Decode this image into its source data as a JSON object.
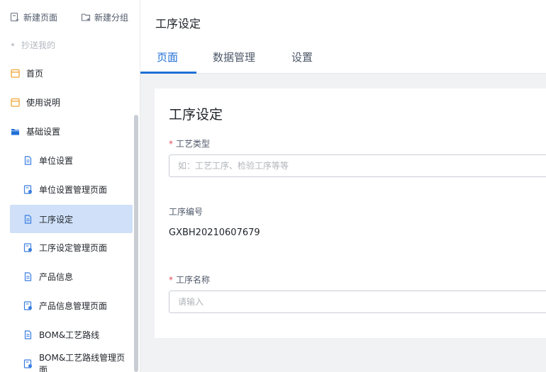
{
  "sidebar": {
    "actions": {
      "new_page": "新建页面",
      "new_group": "新建分组"
    },
    "sub_item": "抄送我的",
    "items": [
      {
        "label": "首页",
        "icon": "calendar-icon"
      },
      {
        "label": "使用说明",
        "icon": "calendar-icon"
      },
      {
        "label": "基础设置",
        "icon": "folder-icon"
      },
      {
        "label": "单位设置",
        "icon": "document-icon"
      },
      {
        "label": "单位设置管理页面",
        "icon": "admin-page-icon"
      },
      {
        "label": "工序设定",
        "icon": "document-icon",
        "active": true
      },
      {
        "label": "工序设定管理页面",
        "icon": "admin-page-icon"
      },
      {
        "label": "产品信息",
        "icon": "document-icon"
      },
      {
        "label": "产品信息管理页面",
        "icon": "admin-page-icon"
      },
      {
        "label": "BOM&工艺路线",
        "icon": "document-icon"
      },
      {
        "label": "BOM&工艺路线管理页面",
        "icon": "admin-page-icon"
      }
    ]
  },
  "header": {
    "title": "工序设定",
    "tabs": [
      {
        "label": "页面",
        "active": true
      },
      {
        "label": "数据管理"
      },
      {
        "label": "设置"
      }
    ]
  },
  "form": {
    "title": "工序设定",
    "craft_type": {
      "label": "工艺类型",
      "required": true,
      "placeholder": "如：工艺工序、检验工序等等",
      "value": ""
    },
    "process_code": {
      "label": "工序编号",
      "value": "GXBH20210607679"
    },
    "process_name": {
      "label": "工序名称",
      "required": true,
      "placeholder": "请输入",
      "value": ""
    }
  },
  "colors": {
    "accent": "#1f6fd6",
    "active_bg": "#cfe0f8",
    "required": "#e34d59",
    "calendar_icon": "#f0a534",
    "document_icon": "#3a7ee0",
    "folder_icon": "#1f6fd6"
  }
}
